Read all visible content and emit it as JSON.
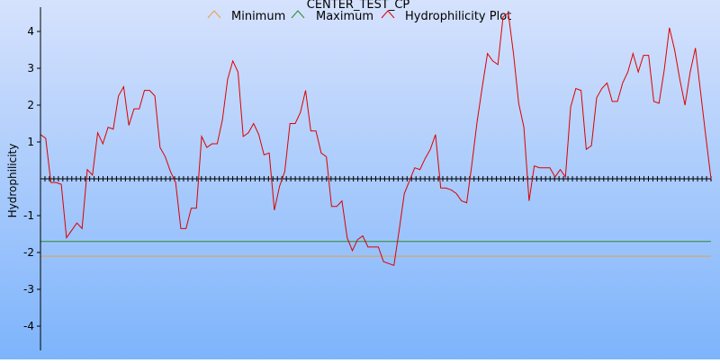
{
  "chart_data": {
    "type": "line",
    "title": "CENTER_TEST_CP",
    "xlabel": "",
    "ylabel": "Hydrophilicity",
    "ylim": [
      -4.7,
      4.7
    ],
    "yticks": [
      {
        "value": 4,
        "label": "4"
      },
      {
        "value": 3,
        "label": "3"
      },
      {
        "value": 2,
        "label": "2"
      },
      {
        "value": 1,
        "label": "1"
      },
      {
        "value": -1,
        "label": "-1"
      },
      {
        "value": -2,
        "label": "-2"
      },
      {
        "value": -3,
        "label": "-3"
      },
      {
        "value": -4,
        "label": "-4"
      }
    ],
    "zero_line_ticks": 150,
    "legend": {
      "placement": "top",
      "items": [
        {
          "label": "Minimum",
          "color": "#e8a040"
        },
        {
          "label": "Maximum",
          "color": "#2a8a2a"
        },
        {
          "label": "Hydrophilicity Plot",
          "color": "#dd0000"
        }
      ]
    },
    "reference_lines": [
      {
        "name": "Minimum",
        "value": -2.1,
        "color": "#e8a040"
      },
      {
        "name": "Maximum",
        "value": -1.7,
        "color": "#2a8a2a"
      }
    ],
    "series": [
      {
        "name": "Hydrophilicity Plot",
        "color": "#dd0000",
        "values": [
          1.2,
          1.1,
          -0.1,
          -0.1,
          -0.15,
          -1.6,
          -1.4,
          -1.2,
          -1.35,
          0.25,
          0.1,
          1.25,
          0.95,
          1.4,
          1.35,
          2.25,
          2.5,
          1.45,
          1.9,
          1.9,
          2.4,
          2.4,
          2.25,
          0.85,
          0.6,
          0.2,
          -0.1,
          -1.35,
          -1.35,
          -0.8,
          -0.8,
          1.15,
          0.85,
          0.95,
          0.95,
          1.6,
          2.7,
          3.2,
          2.9,
          1.15,
          1.25,
          1.5,
          1.2,
          0.65,
          0.7,
          -0.85,
          -0.2,
          0.2,
          1.5,
          1.5,
          1.8,
          2.4,
          1.3,
          1.3,
          0.7,
          0.6,
          -0.75,
          -0.75,
          -0.6,
          -1.6,
          -1.95,
          -1.65,
          -1.55,
          -1.85,
          -1.85,
          -1.85,
          -2.25,
          -2.3,
          -2.35,
          -1.4,
          -0.4,
          -0.05,
          0.3,
          0.25,
          0.55,
          0.8,
          1.2,
          -0.25,
          -0.25,
          -0.3,
          -0.4,
          -0.6,
          -0.65,
          0.4,
          1.55,
          2.5,
          3.4,
          3.2,
          3.1,
          4.4,
          4.5,
          3.4,
          2.05,
          1.4,
          -0.6,
          0.35,
          0.3,
          0.3,
          0.3,
          0.05,
          0.25,
          0.05,
          1.95,
          2.45,
          2.4,
          0.8,
          0.9,
          2.2,
          2.45,
          2.6,
          2.1,
          2.1,
          2.6,
          2.9,
          3.4,
          2.9,
          3.35,
          3.35,
          2.1,
          2.05,
          2.95,
          4.1,
          3.5,
          2.7,
          2.0,
          2.9,
          3.55,
          2.35,
          1.15,
          0.0
        ]
      }
    ]
  }
}
